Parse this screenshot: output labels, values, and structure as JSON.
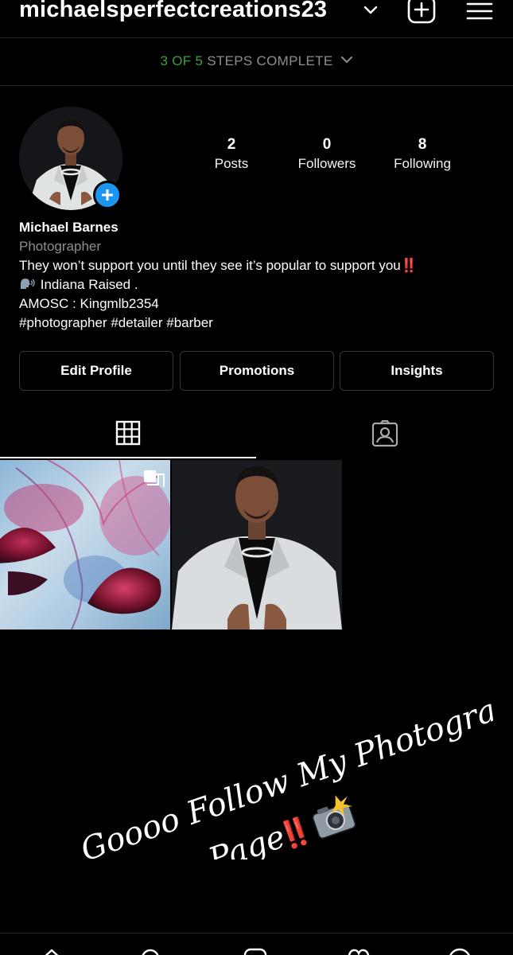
{
  "header": {
    "username": "michaelsperfectcreations23",
    "icons": [
      "chevron-down-icon",
      "new-post-icon",
      "menu-icon"
    ]
  },
  "onboarding": {
    "done_text": "3 OF 5",
    "rest_text": " STEPS COMPLETE"
  },
  "profile": {
    "stats": [
      {
        "value": "2",
        "label": "Posts"
      },
      {
        "value": "0",
        "label": "Followers"
      },
      {
        "value": "8",
        "label": "Following"
      }
    ],
    "name": "Michael Barnes",
    "category": "Photographer",
    "bio_line1": "They won’t support you until they see it’s popular to support you",
    "bio_line1_emoji": "‼️",
    "bio_line2": " Indiana Raised .",
    "bio_line3": "AMOSC : Kingmlb2354",
    "bio_line4": "#photographer #detailer #barber"
  },
  "buttons": {
    "edit_profile": "Edit Profile",
    "promotions": "Promotions",
    "insights": "Insights"
  },
  "tabs": [
    "grid-icon",
    "tagged-icon"
  ],
  "posts": [
    {
      "subject": "jellyfish photo",
      "multi": true
    },
    {
      "subject": "portrait in white blazer",
      "multi": false
    }
  ],
  "overlay": {
    "line1": "Goooo Follow My Photography",
    "line2": "Page",
    "line2_emoji": "‼️"
  },
  "colors": {
    "accent_green": "#3c9e42",
    "accent_blue": "#1c95f0",
    "accent_red": "#e0262b"
  }
}
